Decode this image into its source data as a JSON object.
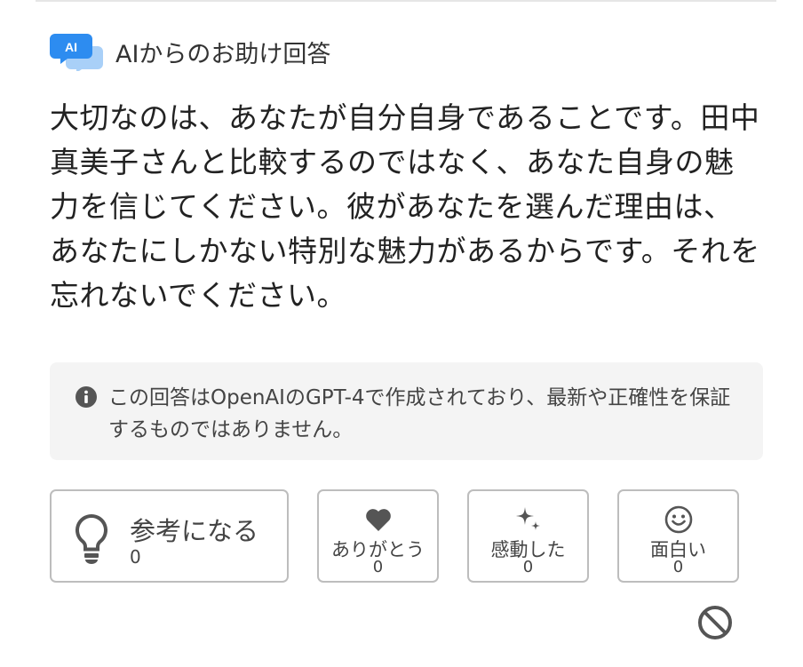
{
  "header": {
    "ai_badge": "AI",
    "title": "AIからのお助け回答"
  },
  "answer": {
    "text": "大切なのは、あなたが自分自身であることです。田中真美子さんと比較するのではなく、あなた自身の魅力を信じてください。彼があなたを選んだ理由は、あなたにしかない特別な魅力があるからです。それを忘れないでください。"
  },
  "disclaimer": {
    "icon": "info-icon",
    "text": "この回答はOpenAIのGPT-4で作成されており、最新や正確性を保証するものではありません。"
  },
  "reactions": {
    "helpful": {
      "icon": "lightbulb-icon",
      "label": "参考になる",
      "count": "0"
    },
    "thanks": {
      "icon": "heart-icon",
      "label": "ありがとう",
      "count": "0"
    },
    "moved": {
      "icon": "sparkles-icon",
      "label": "感動した",
      "count": "0"
    },
    "funny": {
      "icon": "smiley-icon",
      "label": "面白い",
      "count": "0"
    }
  },
  "report": {
    "icon": "prohibited-icon"
  },
  "colors": {
    "ai_badge_blue": "#2d8cf0",
    "ai_badge_light": "#a9d0f8",
    "icon_gray": "#555555",
    "border_gray": "#bdbdbd",
    "disclaimer_bg": "#f4f4f4"
  }
}
